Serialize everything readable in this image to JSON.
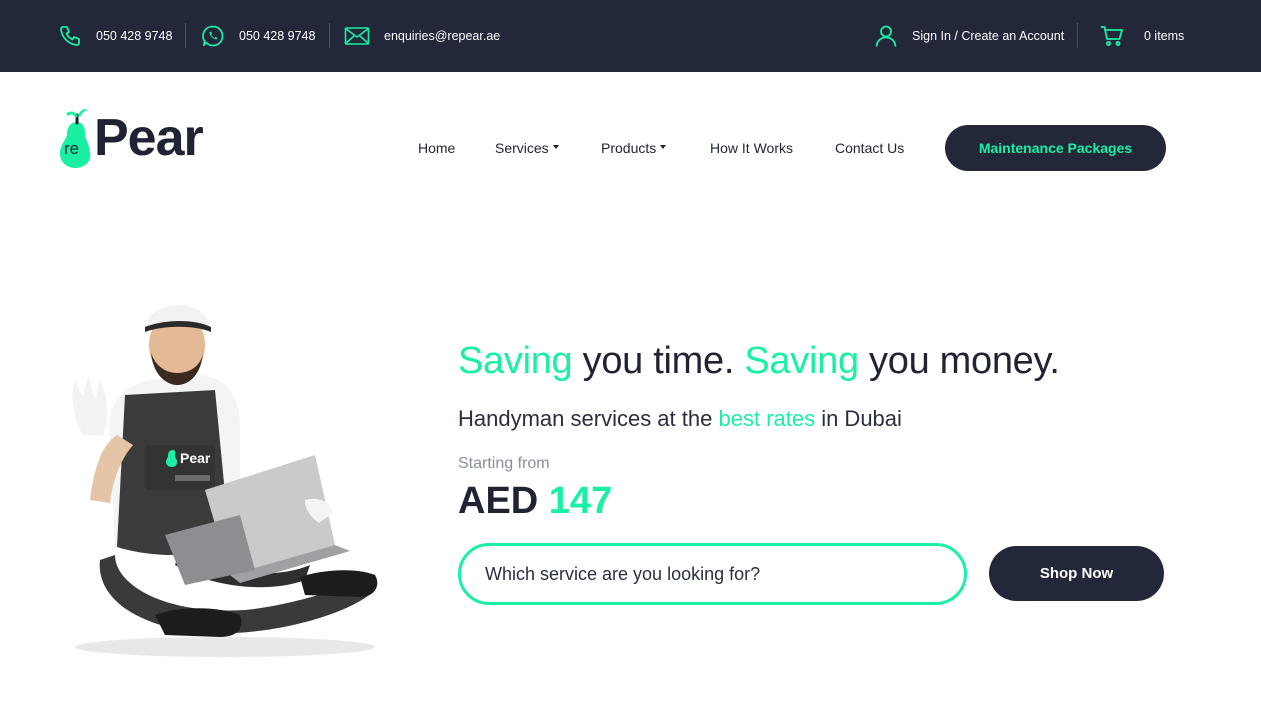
{
  "topbar": {
    "phone": "050 428 9748",
    "whatsapp": "050 428 9748",
    "email": "enquiries@repear.ae",
    "account": "Sign In / Create an Account",
    "cart": "0 items"
  },
  "logo": {
    "prefix": "re",
    "word": "Pear"
  },
  "nav": {
    "home": "Home",
    "services": "Services",
    "products": "Products",
    "how_it_works": "How It Works",
    "contact": "Contact Us",
    "packages_button": "Maintenance Packages"
  },
  "hero": {
    "headline_1": "Saving",
    "headline_2": " you time. ",
    "headline_3": "Saving",
    "headline_4": " you money.",
    "sub_1": "Handyman services at the ",
    "sub_2": "best rates",
    "sub_3": " in Dubai",
    "starting_from": "Starting from",
    "price_currency": "AED ",
    "price_value": "147",
    "search_placeholder": "Which service are you looking for?",
    "shop_button": "Shop Now",
    "apron_logo": "Pear"
  },
  "colors": {
    "accent": "#19f0a3",
    "dark": "#22273a"
  }
}
